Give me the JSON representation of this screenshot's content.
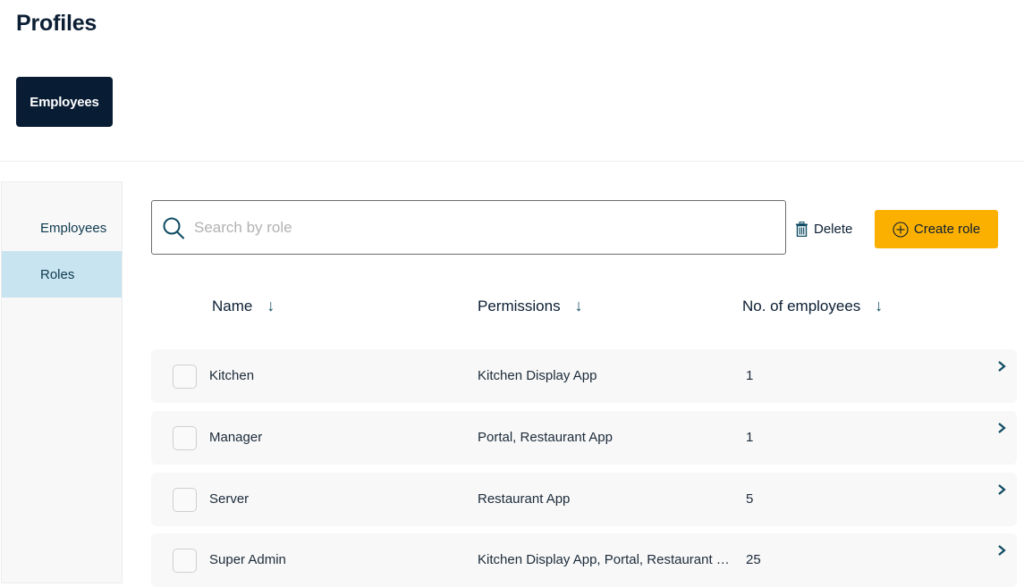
{
  "header": {
    "title": "Profiles",
    "tabs": [
      {
        "label": "Employees",
        "active": true
      }
    ]
  },
  "sidebar": {
    "items": [
      {
        "label": "Employees",
        "active": false
      },
      {
        "label": "Roles",
        "active": true
      }
    ]
  },
  "toolbar": {
    "search_placeholder": "Search by role",
    "search_value": "",
    "search_icon": "search-icon",
    "delete_label": "Delete",
    "delete_icon": "trash-icon",
    "create_label": "Create role",
    "create_icon": "plus-circle-icon"
  },
  "table": {
    "columns": [
      {
        "label": "Name",
        "sort": "descending"
      },
      {
        "label": "Permissions",
        "sort": "descending"
      },
      {
        "label": "No. of employees",
        "sort": "descending"
      }
    ],
    "rows": [
      {
        "name": "Kitchen",
        "permissions": "Kitchen Display App",
        "employees": "1",
        "checked": false
      },
      {
        "name": "Manager",
        "permissions": "Portal, Restaurant App",
        "employees": "1",
        "checked": false
      },
      {
        "name": "Server",
        "permissions": "Restaurant App",
        "employees": "5",
        "checked": false
      },
      {
        "name": "Super Admin",
        "permissions": "Kitchen Display App, Portal, Restaurant …",
        "employees": "25",
        "checked": false
      }
    ]
  },
  "colors": {
    "primary_dark": "#081c33",
    "accent_yellow": "#fbb000",
    "sidebar_active": "#c8e4f1",
    "icon_teal": "#0f4c63",
    "row_bg": "#f8f8f8"
  }
}
